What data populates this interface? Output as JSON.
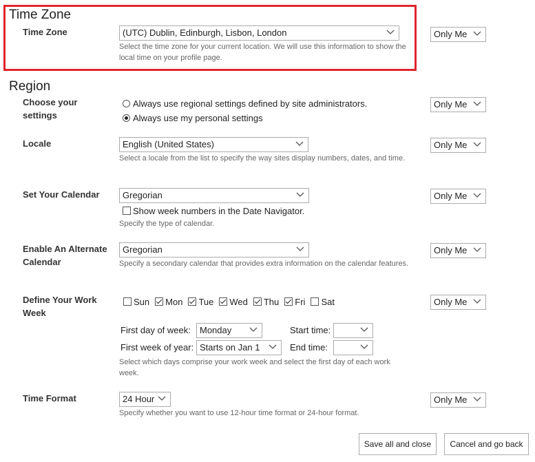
{
  "timezone": {
    "section_title": "Time Zone",
    "label": "Time Zone",
    "value": "(UTC) Dublin, Edinburgh, Lisbon, London",
    "help": "Select the time zone for your current location. We will use this information to show the local time on your profile page.",
    "visibility": "Only Me"
  },
  "region": {
    "section_title": "Region",
    "settings": {
      "label": "Choose your settings",
      "option_site": "Always use regional settings defined by site administrators.",
      "option_personal": "Always use my personal settings",
      "selected": "personal",
      "visibility": "Only Me"
    },
    "locale": {
      "label": "Locale",
      "value": "English (United States)",
      "help": "Select a locale from the list to specify the way sites display numbers, dates, and time.",
      "visibility": "Only Me"
    },
    "calendar": {
      "label": "Set Your Calendar",
      "value": "Gregorian",
      "week_numbers_label": "Show week numbers in the Date Navigator.",
      "week_numbers_checked": false,
      "help": "Specify the type of calendar.",
      "visibility": "Only Me"
    },
    "alt_calendar": {
      "label": "Enable An Alternate Calendar",
      "value": "Gregorian",
      "help": "Specify a secondary calendar that provides extra information on the calendar features.",
      "visibility": "Only Me"
    },
    "work_week": {
      "label": "Define Your Work Week",
      "days": [
        {
          "label": "Sun",
          "checked": false
        },
        {
          "label": "Mon",
          "checked": true
        },
        {
          "label": "Tue",
          "checked": true
        },
        {
          "label": "Wed",
          "checked": true
        },
        {
          "label": "Thu",
          "checked": true
        },
        {
          "label": "Fri",
          "checked": true
        },
        {
          "label": "Sat",
          "checked": false
        }
      ],
      "first_day_label": "First day of week:",
      "first_day_value": "Monday",
      "first_week_label": "First week of year:",
      "first_week_value": "Starts on Jan 1",
      "start_time_label": "Start time:",
      "start_time_value": "",
      "end_time_label": "End time:",
      "end_time_value": "",
      "help": "Select which days comprise your work week and select the first day of each work week.",
      "visibility": "Only Me"
    },
    "time_format": {
      "label": "Time Format",
      "value": "24 Hour",
      "help": "Specify whether you want to use 12-hour time format or 24-hour format.",
      "visibility": "Only Me"
    }
  },
  "buttons": {
    "save": "Save all and close",
    "cancel": "Cancel and go back"
  },
  "colors": {
    "highlight": "#e0242c"
  }
}
